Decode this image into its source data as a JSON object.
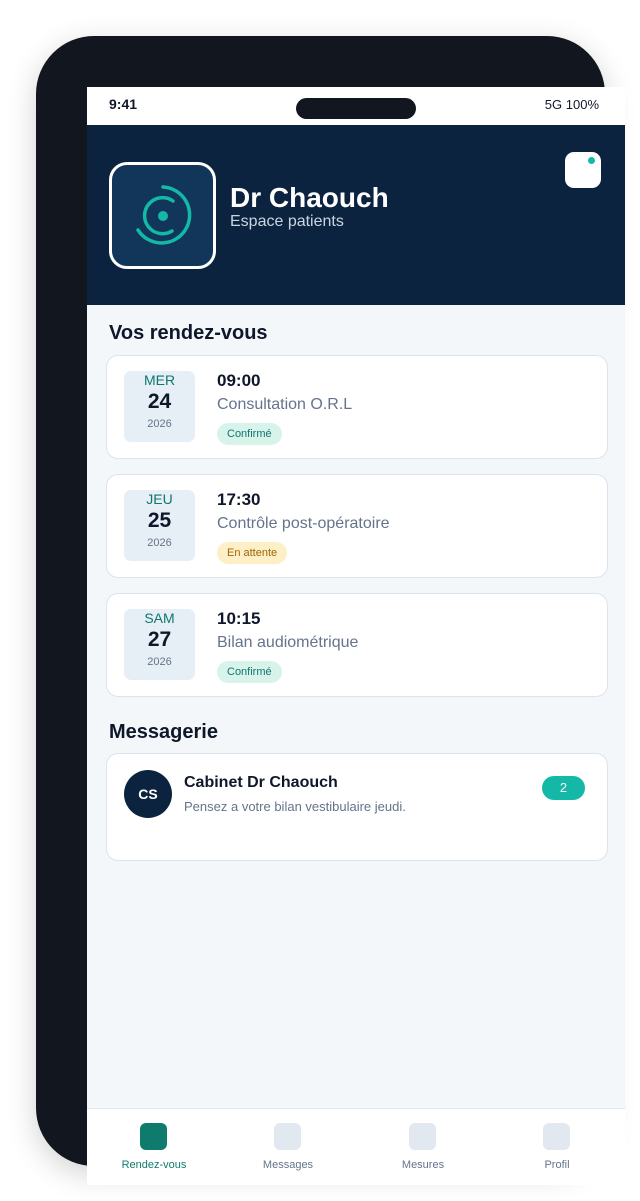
{
  "status": {
    "time": "9:41",
    "signal": "5G  100%"
  },
  "header": {
    "name": "Dr Chaouch",
    "subtitle": "Espace patients",
    "logo_icon": "ring-dot-logo",
    "accent": "#14b8a6"
  },
  "appointments_title": "Vos rendez-vous",
  "appointments": [
    {
      "day": "MER",
      "date": "24",
      "year": "2026",
      "time": "09:00",
      "title": "Consultation O.R.L",
      "status": "Confirmé"
    },
    {
      "day": "JEU",
      "date": "25",
      "year": "2026",
      "time": "17:30",
      "title": "Contrôle post-opératoire",
      "status": "En attente"
    },
    {
      "day": "SAM",
      "date": "27",
      "year": "2026",
      "time": "10:15",
      "title": "Bilan audiométrique",
      "status": "Confirmé"
    }
  ],
  "messages_title": "Messagerie",
  "message": {
    "initials": "CS",
    "sender": "Cabinet Dr Chaouch",
    "preview": "Pensez a votre bilan vestibulaire jeudi.",
    "unread": "2"
  },
  "nav": [
    {
      "label": "Rendez-vous",
      "active": true
    },
    {
      "label": "Messages",
      "active": false
    },
    {
      "label": "Mesures",
      "active": false
    },
    {
      "label": "Profil",
      "active": false
    }
  ]
}
